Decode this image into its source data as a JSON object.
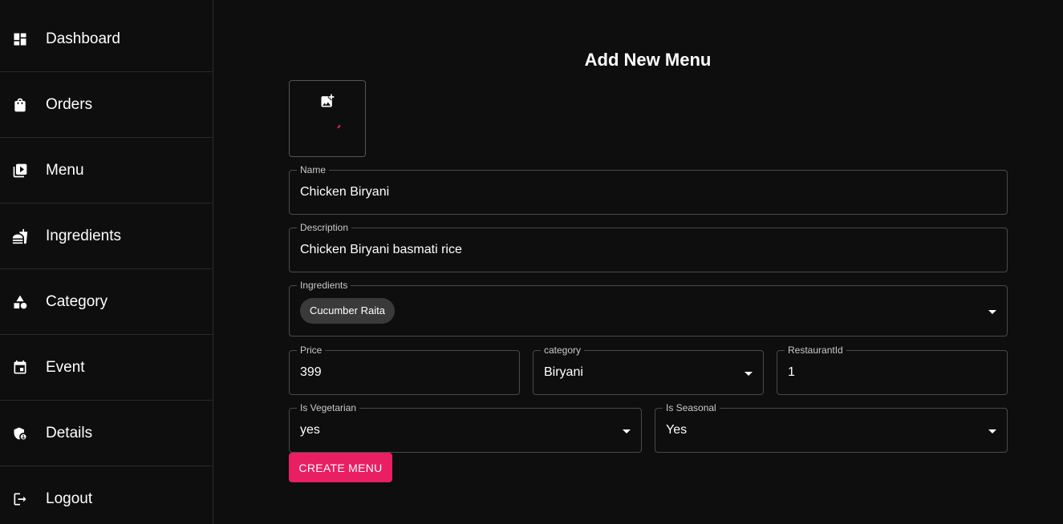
{
  "sidebar": {
    "items": [
      {
        "label": "Dashboard",
        "icon": "dashboard-icon"
      },
      {
        "label": "Orders",
        "icon": "shopping-bag-icon"
      },
      {
        "label": "Menu",
        "icon": "menu-book-icon"
      },
      {
        "label": "Ingredients",
        "icon": "fastfood-icon"
      },
      {
        "label": "Category",
        "icon": "category-icon"
      },
      {
        "label": "Event",
        "icon": "event-icon"
      },
      {
        "label": "Details",
        "icon": "admin-panel-icon"
      },
      {
        "label": "Logout",
        "icon": "logout-icon"
      }
    ]
  },
  "form": {
    "title": "Add New Menu",
    "image_upload_icon": "add-photo-icon",
    "name": {
      "label": "Name",
      "value": "Chicken Biryani"
    },
    "description": {
      "label": "Description",
      "value": "Chicken Biryani basmati rice"
    },
    "ingredients": {
      "label": "Ingredients",
      "chips": [
        "Cucumber Raita"
      ]
    },
    "price": {
      "label": "Price",
      "value": "399"
    },
    "category": {
      "label": "category",
      "value": "Biryani"
    },
    "restaurant_id": {
      "label": "RestaurantId",
      "value": "1"
    },
    "is_vegetarian": {
      "label": "Is Vegetarian",
      "value": "yes"
    },
    "is_seasonal": {
      "label": "Is Seasonal",
      "value": "Yes"
    },
    "submit_label": "CREATE MENU"
  },
  "colors": {
    "background": "#0e0e0e",
    "accent": "#e91e63",
    "border": "#4a4a4a"
  }
}
